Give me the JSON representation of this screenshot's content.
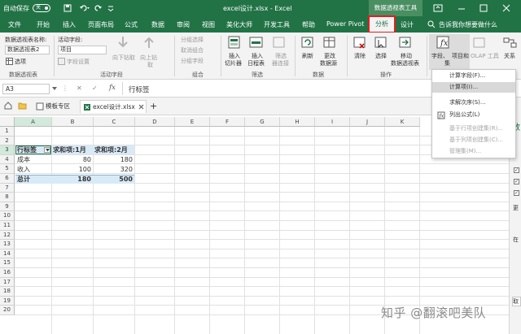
{
  "titlebar": {
    "autosave_label": "自动保存",
    "autosave_state": "关",
    "doc_title": "excel设计.xlsx  -  Excel",
    "context_group": "数据透视表工具"
  },
  "menu": {
    "tabs": [
      "文件",
      "开始",
      "插入",
      "页面布局",
      "公式",
      "数据",
      "审阅",
      "视图",
      "美化大师",
      "开发工具",
      "帮助",
      "Power Pivot",
      "分析",
      "设计"
    ],
    "tell_me": "告诉我你想要做什么"
  },
  "ribbon": {
    "pivot_name_label": "数据透视表名称:",
    "pivot_name_value": "数据透视表2",
    "options": "选项",
    "group_pivot": "数据透视表",
    "active_field_label": "活动字段:",
    "active_field_value": "项目",
    "field_settings": "字段设置",
    "drill_down": "向下钻取",
    "drill_up": "向上钻",
    "drill_up2": "取",
    "group_active_field": "活动字段",
    "group_selection": "分组选择",
    "ungroup": "取消组合",
    "group_field": "分组字段",
    "group_group": "组合",
    "insert_slicer": "插入",
    "insert_slicer2": "切片器",
    "insert_timeline": "插入",
    "insert_timeline2": "日程表",
    "filter_connections": "筛选",
    "filter_connections2": "器连接",
    "group_filter": "筛选",
    "refresh": "刷新",
    "change_source": "更改",
    "change_source2": "数据源",
    "group_data": "数据",
    "clear": "清除",
    "select": "选择",
    "move_pivot": "移动",
    "move_pivot2": "数据透视表",
    "group_actions": "操作",
    "fields_items": "字段、",
    "fields_items2": "项目和",
    "fields_items3": "集",
    "olap_tools": "OLAP 工具",
    "relationships": "关系"
  },
  "formula_bar": {
    "name_box": "A3",
    "cancel": "✕",
    "enter": "✓",
    "fx": "fx",
    "content": "行标签"
  },
  "doc_tabs": {
    "template": "模板专区",
    "file": "excel设计.xlsx",
    "add": "+"
  },
  "grid": {
    "columns": [
      "A",
      "B",
      "C",
      "D",
      "E",
      "F",
      "G",
      "H",
      "I",
      "J",
      "K"
    ],
    "rows": [
      "1",
      "2",
      "3",
      "4",
      "5",
      "6",
      "7",
      "8",
      "9",
      "10",
      "11",
      "12",
      "13",
      "14",
      "15",
      "16",
      "17",
      "18",
      "19",
      "20"
    ],
    "header_row": [
      "行标签",
      "求和项:1月",
      "求和项:2月"
    ],
    "data": [
      [
        "成本",
        "80",
        "180"
      ],
      [
        "收入",
        "100",
        "320"
      ],
      [
        "总计",
        "180",
        "500"
      ]
    ]
  },
  "dropdown": {
    "items": [
      {
        "label": "计算字段(F)...",
        "enabled": true
      },
      {
        "label": "计算项(I)...",
        "enabled": true,
        "highlighted": true
      },
      {
        "label": "求解次序(S)...",
        "enabled": true
      },
      {
        "label": "列出公式(L)",
        "enabled": true
      },
      {
        "label": "基于行项创建集(R)...",
        "enabled": false
      },
      {
        "label": "基于列项创建集(C)...",
        "enabled": false
      },
      {
        "label": "管理集(M)...",
        "enabled": false
      }
    ]
  },
  "sidepane": {
    "frag1": "数",
    "frag2": "更",
    "frag3": "在",
    "frag4": "取"
  },
  "watermark": "知乎 @翻滚吧美队",
  "colors": {
    "excel_green": "#217346",
    "highlight_red": "#e41d1d",
    "selection_header": "#d2e9dc"
  }
}
